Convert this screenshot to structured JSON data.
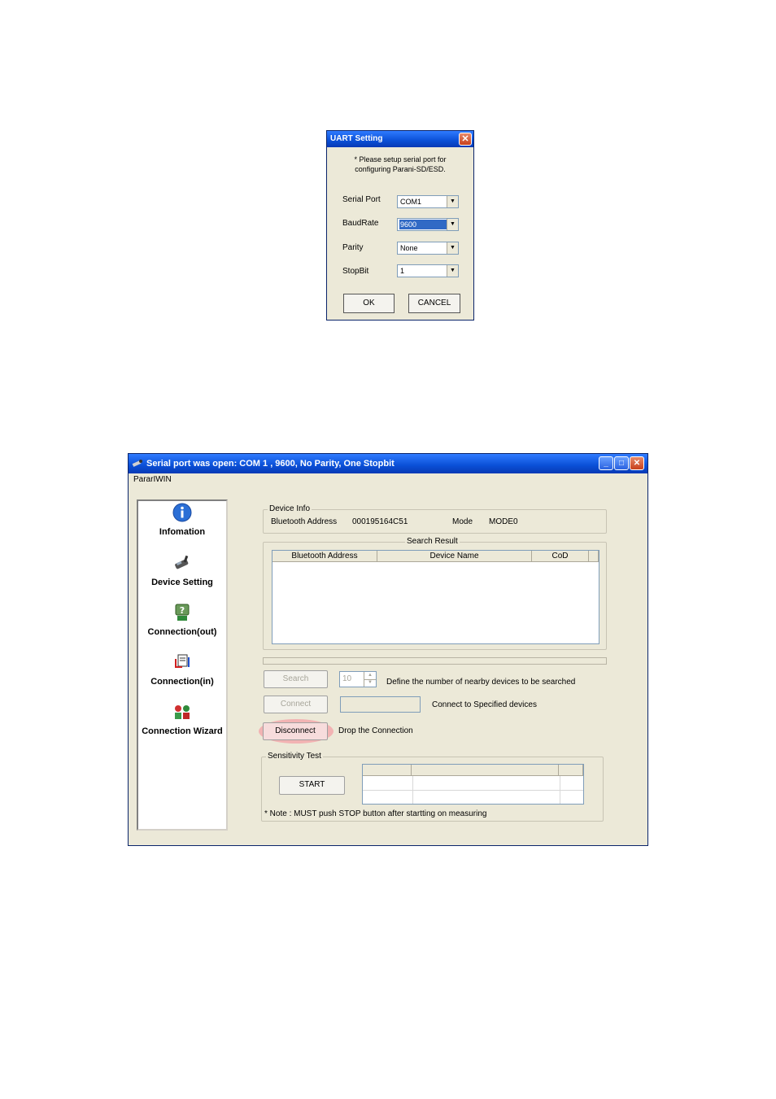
{
  "uart_dialog": {
    "title": "UART Setting",
    "close_glyph": "✕",
    "note_line1": "* Please setup serial port for",
    "note_line2": "configuring Parani-SD/ESD.",
    "serial_port_label": "Serial Port",
    "serial_port_value": "COM1",
    "baudrate_label": "BaudRate",
    "baudrate_value": "9600",
    "parity_label": "Parity",
    "parity_value": "None",
    "stopbit_label": "StopBit",
    "stopbit_value": "1",
    "ok_label": "OK",
    "cancel_label": "CANCEL",
    "dropdown_glyph": "▼"
  },
  "main_window": {
    "title": "Serial port was open: COM 1 , 9600, No Parity, One Stopbit",
    "menu": "PararIWIN",
    "minimize_glyph": "_",
    "maximize_glyph": "□",
    "close_glyph": "✕",
    "sidebar": {
      "items": [
        {
          "label": "Infomation",
          "icon": "info-icon"
        },
        {
          "label": "Device Setting",
          "icon": "device-setting-icon"
        },
        {
          "label": "Connection(out)",
          "icon": "connection-out-icon"
        },
        {
          "label": "Connection(in)",
          "icon": "connection-in-icon"
        },
        {
          "label": "Connection Wizard",
          "icon": "connection-wizard-icon"
        }
      ]
    },
    "device_info": {
      "title": "Device Info",
      "bt_address_label": "Bluetooth Address",
      "bt_address_value": "000195164C51",
      "mode_label": "Mode",
      "mode_value": "MODE0"
    },
    "search_result": {
      "title": "Search Result",
      "columns": [
        "Bluetooth Address",
        "Device Name",
        "CoD"
      ]
    },
    "search_button": "Search",
    "search_count": "10",
    "search_desc": "Define the number of nearby devices to be searched",
    "connect_button": "Connect",
    "connect_desc": "Connect to Specified devices",
    "disconnect_button": "Disconnect",
    "disconnect_desc": "Drop the Connection",
    "sensitivity": {
      "title": "Sensitivity Test",
      "start_button": "START",
      "note": "* Note : MUST push STOP button after startting on measuring"
    },
    "colors": {
      "title_bar": "#0a4fd6",
      "disconnect_highlight": "#f2b3b3"
    }
  }
}
